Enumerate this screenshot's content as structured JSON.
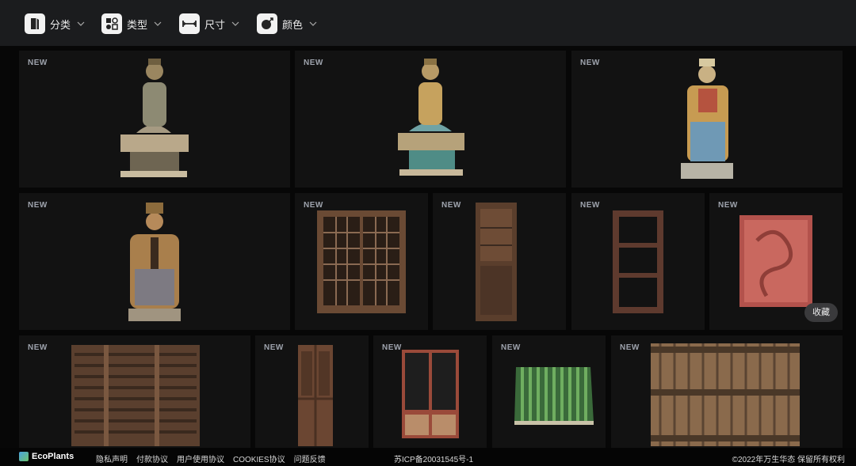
{
  "filters": [
    {
      "label": "分类",
      "icon": "book-icon"
    },
    {
      "label": "类型",
      "icon": "grid-shapes-icon"
    },
    {
      "label": "尺寸",
      "icon": "ruler-icon"
    },
    {
      "label": "颜色",
      "icon": "palette-icon"
    }
  ],
  "tiles": [
    {
      "badge": "NEW",
      "item": "seated-buddha-statue"
    },
    {
      "badge": "NEW",
      "item": "seated-bodhisattva-statue"
    },
    {
      "badge": "NEW",
      "item": "seated-official-statue"
    },
    {
      "badge": "NEW",
      "item": "seated-judge-statue"
    },
    {
      "badge": "NEW",
      "item": "lattice-window-pair"
    },
    {
      "badge": "NEW",
      "item": "wooden-door"
    },
    {
      "badge": "NEW",
      "item": "wooden-window-frame"
    },
    {
      "badge": "NEW",
      "item": "red-dragon-relief-panel",
      "action": "收藏"
    },
    {
      "badge": "NEW",
      "item": "wooden-shelf-rack"
    },
    {
      "badge": "NEW",
      "item": "carved-door-panel"
    },
    {
      "badge": "NEW",
      "item": "red-glass-door"
    },
    {
      "badge": "NEW",
      "item": "green-glazed-roof-tiles"
    },
    {
      "badge": "NEW",
      "item": "timber-ceiling-section"
    }
  ],
  "footer": {
    "brand": "EcoPlants",
    "links": [
      "隐私声明",
      "付款协议",
      "用户使用协议",
      "COOKIES协议",
      "问题反馈"
    ],
    "icp": "苏ICP备20031545号-1",
    "copyright": "©2022年万生华态 保留所有权利"
  },
  "colors": {
    "topbar": "#1b1c1e",
    "tile": "#121212",
    "badge": "#9ea3ad",
    "background": "#070707"
  }
}
